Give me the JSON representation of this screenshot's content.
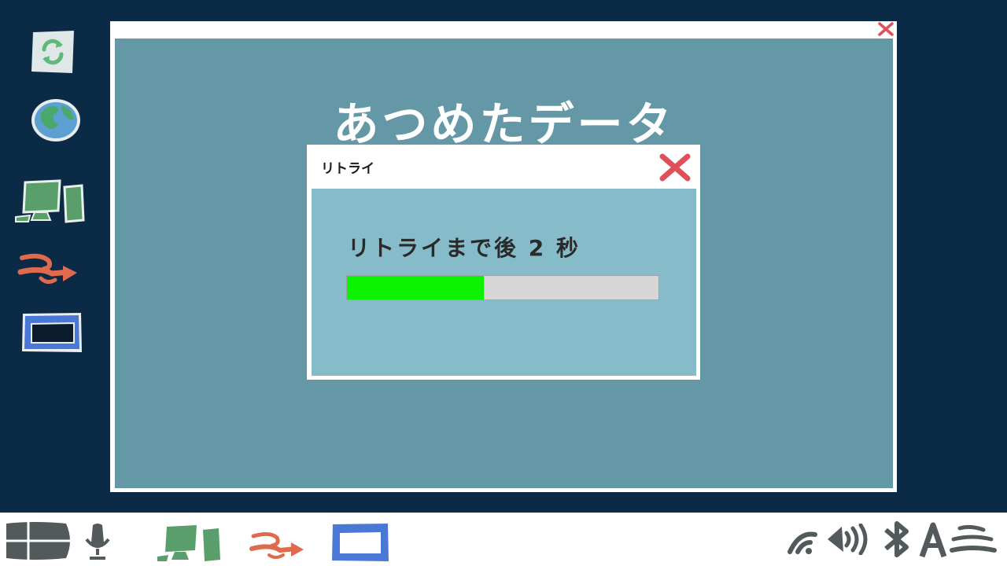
{
  "desktop": {
    "icons": [
      "recycle-icon",
      "globe-icon",
      "computer-icon",
      "share-arrow-icon",
      "window-icon"
    ]
  },
  "main_window": {
    "title": "あつめたデータ",
    "close_icon": "close-icon"
  },
  "dialog": {
    "title": "リトライ",
    "message": "リトライまで後 2 秒",
    "progress": 0.44,
    "close_icon": "close-icon"
  },
  "taskbar": {
    "left_icons": [
      "start-menu-icon",
      "microphone-icon",
      "computer-icon",
      "share-arrow-icon",
      "window-icon"
    ],
    "tray_icons": [
      "wifi-icon",
      "volume-icon",
      "bluetooth-icon",
      "font-a-icon",
      "menu-lines-icon"
    ]
  },
  "colors": {
    "desktop_bg": "#0b2a46",
    "window_bg": "#6598a6",
    "dialog_body": "#86bbca",
    "progress_fill": "#0cf200",
    "close_red": "#e0505a"
  }
}
